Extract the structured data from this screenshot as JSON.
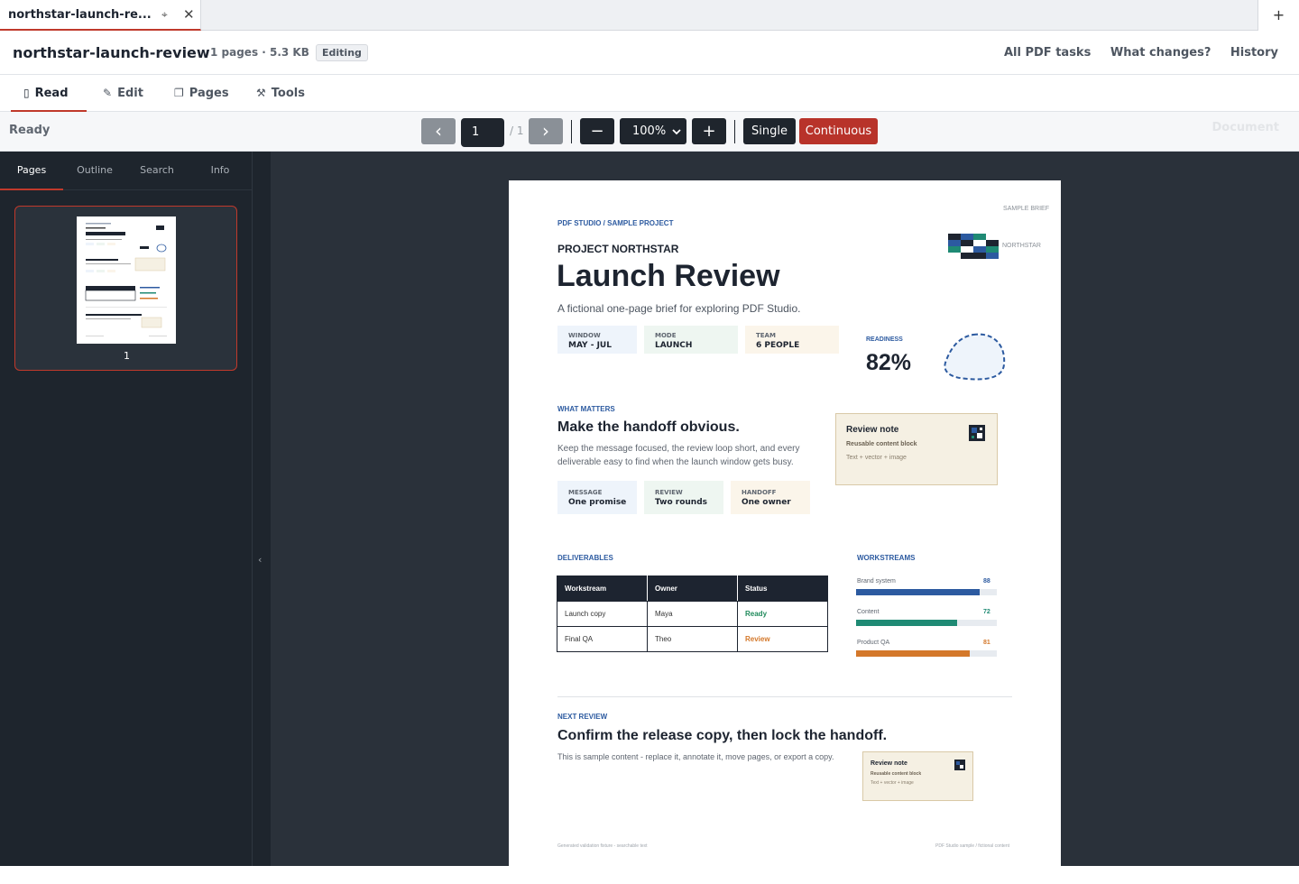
{
  "tab": {
    "title": "northstar-launch-re...",
    "pin_glyph": "⌖",
    "close_glyph": "✕",
    "newtab_glyph": "+"
  },
  "header": {
    "doc_title": "northstar-launch-review",
    "meta": "1 pages · 5.3 KB",
    "badge": "Editing",
    "links": [
      "All PDF tasks",
      "What changes?",
      "History"
    ]
  },
  "modes": [
    {
      "label": "Read",
      "icon": "book-icon",
      "glyph": "▯"
    },
    {
      "label": "Edit",
      "icon": "pencil-icon",
      "glyph": "✎"
    },
    {
      "label": "Pages",
      "icon": "pages-icon",
      "glyph": "❐"
    },
    {
      "label": "Tools",
      "icon": "tools-icon",
      "glyph": "⚒"
    }
  ],
  "toolbar": {
    "status": "Ready",
    "prev_glyph": "‹",
    "next_glyph": "›",
    "page_value": "1",
    "page_total": "/ 1",
    "zoom_out_glyph": "−",
    "zoom_value": "100%",
    "zoom_in_glyph": "+",
    "single_label": "Single",
    "continuous_label": "Continuous",
    "doc_label": "Document"
  },
  "sidebar": {
    "tabs": [
      "Pages",
      "Outline",
      "Search",
      "Info"
    ],
    "thumb_page_number": "1",
    "collapse_glyph": "‹"
  },
  "document": {
    "sample_brief": "SAMPLE BRIEF",
    "breadcrumb": "PDF STUDIO / SAMPLE PROJECT",
    "project": "PROJECT NORTHSTAR",
    "title": "Launch Review",
    "subtitle": "A fictional one-page brief for exploring PDF Studio.",
    "logo_label": "NORTHSTAR",
    "stats": [
      {
        "label": "WINDOW",
        "value": "MAY - JUL",
        "color": "#eef4fb"
      },
      {
        "label": "MODE",
        "value": "LAUNCH",
        "color": "#eef6f1"
      },
      {
        "label": "TEAM",
        "value": "6 PEOPLE",
        "color": "#fbf5ea"
      }
    ],
    "readiness_label": "READINESS",
    "readiness_value": "82%",
    "what_matters_label": "WHAT MATTERS",
    "what_matters_heading": "Make the handoff obvious.",
    "what_matters_body_1": "Keep the message focused, the review loop short, and every",
    "what_matters_body_2": "deliverable easy to find when the launch window gets busy.",
    "pills": [
      {
        "label": "MESSAGE",
        "value": "One promise",
        "color": "#eef4fb"
      },
      {
        "label": "REVIEW",
        "value": "Two rounds",
        "color": "#eef6f1"
      },
      {
        "label": "HANDOFF",
        "value": "One owner",
        "color": "#fbf5ea"
      }
    ],
    "review_note": {
      "title": "Review note",
      "sub": "Reusable content block",
      "detail": "Text + vector + image"
    },
    "deliverables_label": "DELIVERABLES",
    "table": {
      "headers": [
        "Workstream",
        "Owner",
        "Status"
      ],
      "rows": [
        [
          "Launch copy",
          "Maya",
          "Ready"
        ],
        [
          "Final QA",
          "Theo",
          "Review"
        ]
      ],
      "status_colors": {
        "Ready": "#1f8a5b",
        "Review": "#d4782a"
      }
    },
    "workstreams_label": "WORKSTREAMS",
    "workstreams": [
      {
        "name": "Brand system",
        "value": 88,
        "label": "88",
        "color": "#2c5aa0"
      },
      {
        "name": "Content",
        "value": 72,
        "label": "72",
        "color": "#1f8a74"
      },
      {
        "name": "Product QA",
        "value": 81,
        "label": "81",
        "color": "#d4782a"
      }
    ],
    "next_review_label": "NEXT REVIEW",
    "next_review_heading": "Confirm the release copy, then lock the handoff.",
    "next_review_body": "This is sample content - replace it, annotate it, move pages, or export a copy.",
    "footer_left": "Generated validation fixture - searchable text",
    "footer_right": "PDF Studio sample / fictional content"
  }
}
